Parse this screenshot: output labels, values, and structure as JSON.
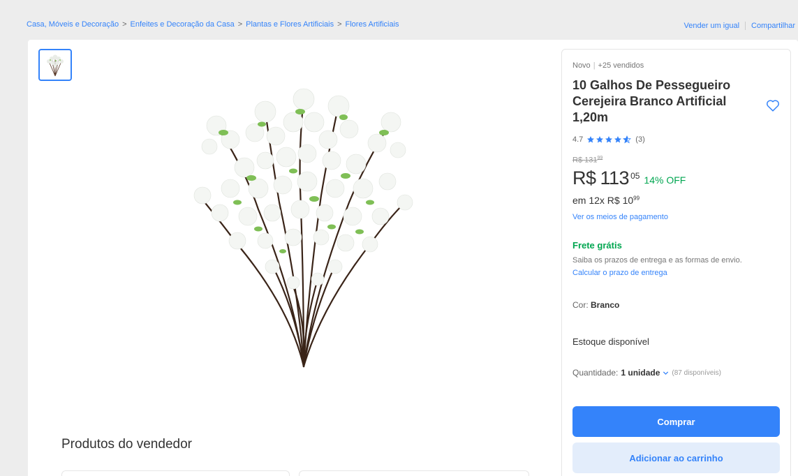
{
  "breadcrumb": [
    "Casa, Móveis e Decoração",
    "Enfeites e Decoração da Casa",
    "Plantas e Flores Artificiais",
    "Flores Artificiais"
  ],
  "breadcrumb_separator": ">",
  "top_actions": {
    "sell_same": "Vender um igual",
    "share": "Compartilhar"
  },
  "product": {
    "condition": "Novo",
    "sold": "+25 vendidos",
    "title": "10 Galhos De Pessegueiro Cerejeira Branco Artificial 1,20m",
    "rating_value": "4.7",
    "rating_stars": 4.7,
    "rating_count": "(3)",
    "original_price": "R$ 131",
    "original_cents": "99",
    "price_currency": "R$",
    "price_main": "113",
    "price_cents": "05",
    "discount": "14% OFF",
    "installments_prefix": "em 12x R$ 10",
    "installments_cents": "99",
    "payment_link": "Ver os meios de pagamento",
    "free_shipping": "Frete grátis",
    "shipping_info": "Saiba os prazos de entrega e as formas de envio.",
    "shipping_link": "Calcular o prazo de entrega",
    "color_label": "Cor:",
    "color_value": "Branco",
    "stock": "Estoque disponível",
    "qty_label": "Quantidade:",
    "qty_value": "1 unidade",
    "qty_available": "(87 disponíveis)"
  },
  "buttons": {
    "buy": "Comprar",
    "add_to_cart": "Adicionar ao carrinho"
  },
  "seller_section": {
    "title": "Produtos do vendedor"
  },
  "colors": {
    "accent": "#3483fa",
    "green": "#00a650",
    "cart_bg": "#e3edfb"
  },
  "icons": {
    "favorite": "heart-outline-icon",
    "star": "star-icon",
    "dropdown": "chevron-down-icon"
  }
}
